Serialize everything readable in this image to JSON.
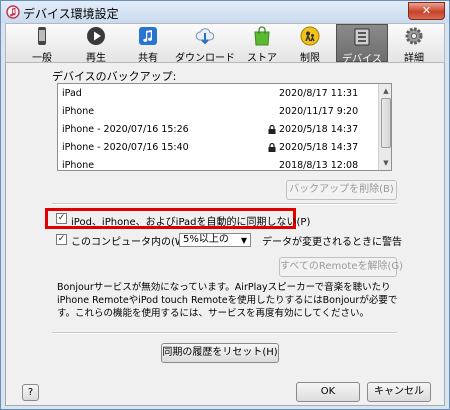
{
  "window": {
    "title": "デバイス環境設定",
    "close_glyph": "✕"
  },
  "toolbar": {
    "items": [
      {
        "label": "一般",
        "icon": "phone-icon"
      },
      {
        "label": "再生",
        "icon": "play-icon"
      },
      {
        "label": "共有",
        "icon": "music-note-icon"
      },
      {
        "label": "ダウンロード",
        "icon": "download-icon"
      },
      {
        "label": "ストア",
        "icon": "shopping-bag-icon"
      },
      {
        "label": "制限",
        "icon": "parental-control-icon"
      },
      {
        "label": "デバイス",
        "icon": "device-icon",
        "active": true
      },
      {
        "label": "詳細",
        "icon": "gear-icon"
      }
    ]
  },
  "backups": {
    "heading": "デバイスのバックアップ:",
    "rows": [
      {
        "name": "iPad",
        "date": "2020/8/17 11:31",
        "locked": false
      },
      {
        "name": "iPhone",
        "date": "2020/11/17 9:20",
        "locked": false
      },
      {
        "name": "iPhone - 2020/07/16 15:26",
        "date": "2020/5/18 14:37",
        "locked": true
      },
      {
        "name": "iPhone - 2020/07/16 15:40",
        "date": "2020/5/18 14:37",
        "locked": true
      },
      {
        "name": "iPhone",
        "date": "2018/8/13 12:08",
        "locked": false
      }
    ],
    "delete_button": "バックアップを削除(B)"
  },
  "options": {
    "prevent_sync_label": "iPod、iPhone、およびiPadを自動的に同期しない(P)",
    "prevent_sync_checked": true,
    "warn_label_prefix": "このコンピュータ内の(W)",
    "warn_checked": true,
    "warn_select_value": "5%以上の",
    "warn_label_suffix": "データが変更されるときに警告"
  },
  "remote": {
    "remove_all_button": "すべてのRemoteを解除(G)",
    "bonjour_text": "Bonjourサービスが無効になっています。AirPlayスピーカーで音楽を聴いたりiPhone RemoteやiPod touch Remoteを使用したりするにはBonjourが必要です。これらの機能を使用するには、サービスを再度有効にしてください。"
  },
  "reset_button": "同期の履歴をリセット(H)",
  "footer": {
    "help": "?",
    "ok": "OK",
    "cancel": "キャンセル"
  },
  "colors": {
    "highlight": "#e00000",
    "titlebar": "#c9dbef",
    "active_tab": "#6e6e6e"
  }
}
